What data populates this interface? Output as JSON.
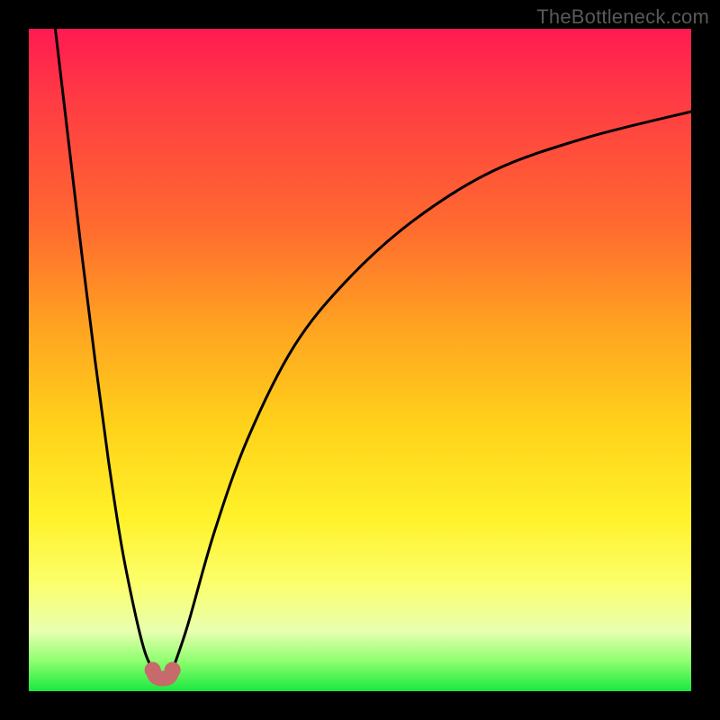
{
  "watermark": "TheBottleneck.com",
  "domain": "Chart",
  "colors": {
    "frame": "#000000",
    "gradient_top": "#ff1a52",
    "gradient_bottom": "#19e840",
    "curve_stroke": "#000000",
    "marker_fill": "#c76a6c"
  },
  "chart_data": {
    "type": "line",
    "title": "",
    "xlabel": "",
    "ylabel": "",
    "xlim": [
      0,
      100
    ],
    "ylim": [
      0,
      100
    ],
    "grid": false,
    "legend": false,
    "note": "No numeric axis ticks or data labels are visible; values are estimated from pixel positions on a 0–100 normalized scale (x left→right, y bottom→top).",
    "series": [
      {
        "name": "left-branch",
        "description": "Steep descending curve from top-left down to the valley.",
        "x": [
          4.0,
          6.0,
          8.0,
          10.0,
          12.0,
          14.0,
          16.0,
          17.5,
          18.7
        ],
        "y": [
          100.0,
          83.0,
          66.0,
          50.0,
          35.0,
          22.0,
          12.0,
          6.0,
          3.2
        ]
      },
      {
        "name": "right-branch",
        "description": "Curve rising from the valley, concave, leveling off toward the right edge.",
        "x": [
          21.7,
          24.0,
          28.0,
          33.0,
          40.0,
          48.0,
          58.0,
          70.0,
          84.0,
          100.0
        ],
        "y": [
          3.2,
          10.0,
          24.0,
          38.0,
          52.0,
          62.0,
          71.0,
          78.5,
          83.5,
          87.5
        ]
      },
      {
        "name": "valley-markers",
        "description": "Thick red-brown U-shaped marker blob at the curve minimum.",
        "x": [
          18.7,
          19.2,
          20.2,
          21.2,
          21.7
        ],
        "y": [
          3.2,
          2.2,
          1.9,
          2.2,
          3.2
        ]
      }
    ],
    "minimum": {
      "x_pct": 20.0,
      "y_pct": 2.0
    }
  }
}
